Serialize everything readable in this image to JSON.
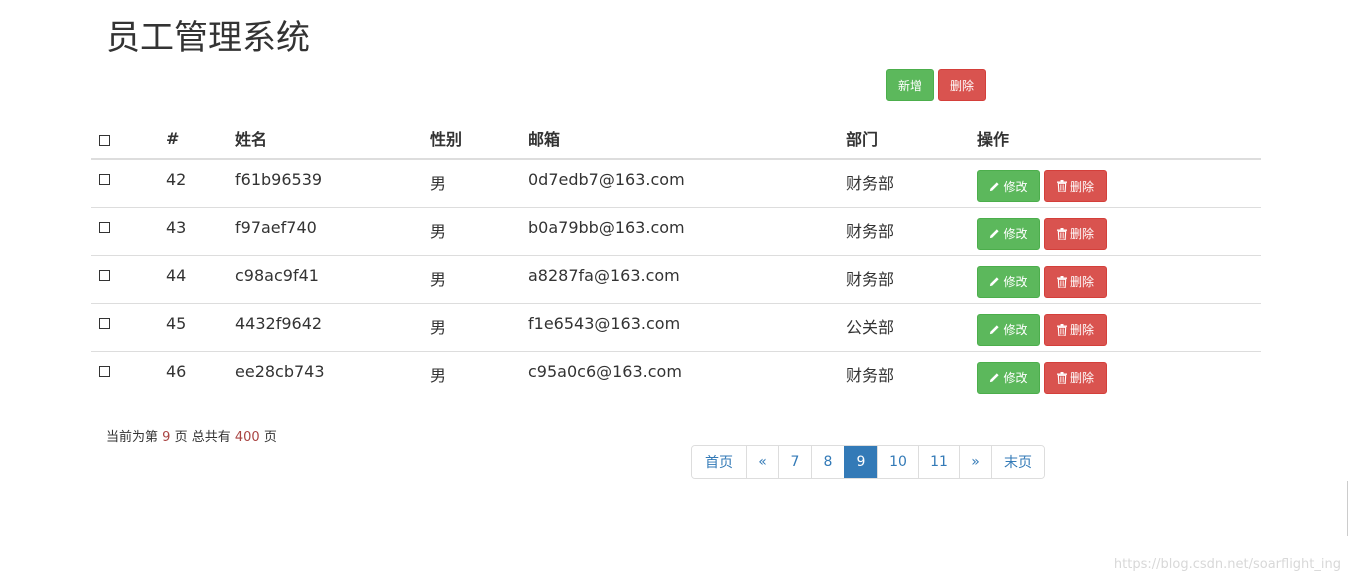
{
  "page": {
    "title": "员工管理系统"
  },
  "toolbar": {
    "add_label": "新增",
    "delete_label": "删除"
  },
  "table": {
    "headers": {
      "id": "#",
      "name": "姓名",
      "gender": "性别",
      "email": "邮箱",
      "dept": "部门",
      "ops": "操作"
    },
    "rows": [
      {
        "id": "42",
        "name": "f61b96539",
        "gender": "男",
        "email": "0d7edb7@163.com",
        "dept": "财务部"
      },
      {
        "id": "43",
        "name": "f97aef740",
        "gender": "男",
        "email": "b0a79bb@163.com",
        "dept": "财务部"
      },
      {
        "id": "44",
        "name": "c98ac9f41",
        "gender": "男",
        "email": "a8287fa@163.com",
        "dept": "财务部"
      },
      {
        "id": "45",
        "name": "4432f9642",
        "gender": "男",
        "email": "f1e6543@163.com",
        "dept": "公关部"
      },
      {
        "id": "46",
        "name": "ee28cb743",
        "gender": "男",
        "email": "c95a0c6@163.com",
        "dept": "财务部"
      }
    ],
    "edit_label": "修改",
    "delete_label": "删除"
  },
  "page_info": {
    "prefix": "当前为第",
    "current": "9",
    "middle": "页 总共有",
    "total": "400",
    "suffix": "页"
  },
  "pagination": {
    "first": "首页",
    "prev": "«",
    "pages": [
      "7",
      "8",
      "9",
      "10",
      "11"
    ],
    "active": "9",
    "next": "»",
    "last": "末页"
  },
  "watermark": "https://blog.csdn.net/soarflight_ing",
  "colors": {
    "success": "#5cb85c",
    "danger": "#d9534f",
    "link": "#337ab7"
  }
}
